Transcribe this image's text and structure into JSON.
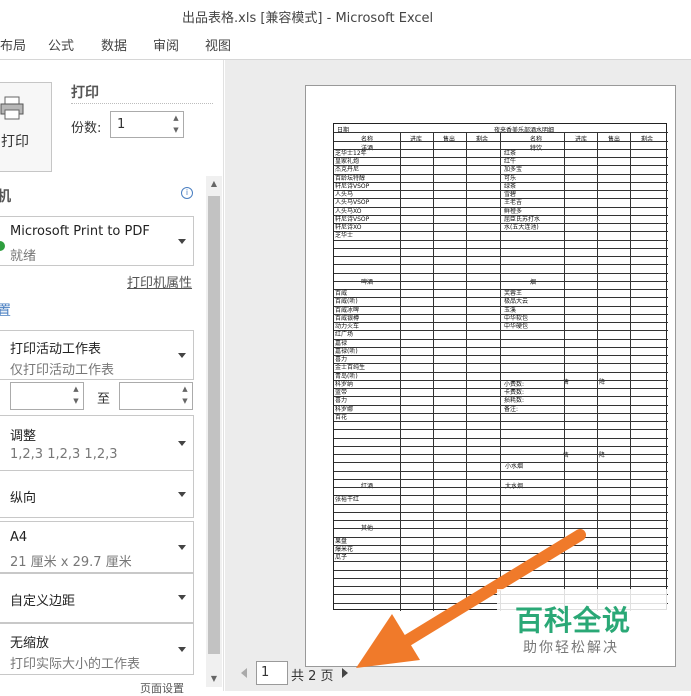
{
  "window": {
    "title": "出品表格.xls  [兼容模式]  -  Microsoft Excel"
  },
  "ribbon": {
    "tabs": [
      "布局",
      "公式",
      "数据",
      "审阅",
      "视图"
    ]
  },
  "print": {
    "button_label": "打印",
    "heading": "打印",
    "copies_label": "份数:",
    "copies_value": "1"
  },
  "printer": {
    "heading": "机",
    "name": "Microsoft Print to PDF",
    "status": "就绪",
    "properties_link": "打印机属性"
  },
  "settings": {
    "heading": "置",
    "print_what": {
      "title": "打印活动工作表",
      "subtitle": "仅打印活动工作表"
    },
    "pages_to": "至",
    "collate": {
      "title": "调整",
      "subtitle": "1,2,3    1,2,3    1,2,3"
    },
    "orientation": "纵向",
    "paper": {
      "title": "A4",
      "subtitle": "21 厘米 x 29.7 厘米"
    },
    "margins": "自定义边距",
    "scaling": {
      "title": "无缩放",
      "subtitle": "打印实际大小的工作表"
    },
    "page_setup": "页面设置"
  },
  "pager": {
    "current": "1",
    "total": "共 2 页"
  },
  "sheet": {
    "title": "夜来香美乐部酒水明细",
    "header_left": "日期",
    "cols_left": [
      "名称",
      "进库",
      "售出",
      "剩余"
    ],
    "cols_right": [
      "名称",
      "进库",
      "售出",
      "剩余"
    ],
    "section_left_1": "洋酒",
    "section_right_1": "特饮",
    "left_items_1": [
      "芝华士12年",
      "皇家礼炮",
      "杰克丹尼",
      "百龄坛特醇",
      "轩尼诗VSOP",
      "人头马",
      "人头马VSOP",
      "人头马XO",
      "轩尼诗VSOP",
      "轩尼诗XO",
      "芝华士"
    ],
    "right_items_1": [
      "红茶",
      "红牛",
      "加多宝",
      "可乐",
      "绿茶",
      "雪碧",
      "王老吉",
      "鲜橙多",
      "屈臣氏苏打水",
      "水(五大连池)"
    ],
    "section_left_2": "啤酒",
    "section_right_2": "烟",
    "left_items_2": [
      "百威",
      "百威(听)",
      "百威冰啤",
      "百威银樽",
      "动力火车",
      "红广场",
      "嘉禄",
      "嘉禄(听)",
      "喜力",
      "金士百纯生",
      "青岛(听)",
      "科罗纳",
      "蓝带",
      "喜力",
      "科罗娜",
      "百花"
    ],
    "right_items_2": [
      "芙蓉王",
      "极品大云",
      "玉溪",
      "中华软包",
      "中华硬包"
    ],
    "right_items_2b": [
      "小费数:",
      "卡费数:",
      "损耗数:",
      "备注:"
    ],
    "right_small_1": "售",
    "right_small_2": "降",
    "right_small_3": "售",
    "right_small_4": "降",
    "right_small_5": "小水烟",
    "section_left_3": "红酒",
    "section_right_3": "大水烟",
    "left_items_3": [
      "张裕干红"
    ],
    "section_left_4": "其他",
    "left_items_4": [
      "果盘",
      "爆米花",
      "瓜子"
    ]
  },
  "watermark": {
    "title": "百科全说",
    "subtitle": "助你轻松解决"
  },
  "colors": {
    "accent_green": "#2aa876",
    "arrow_orange": "#f07a2a",
    "preview_bg": "#ececec"
  }
}
